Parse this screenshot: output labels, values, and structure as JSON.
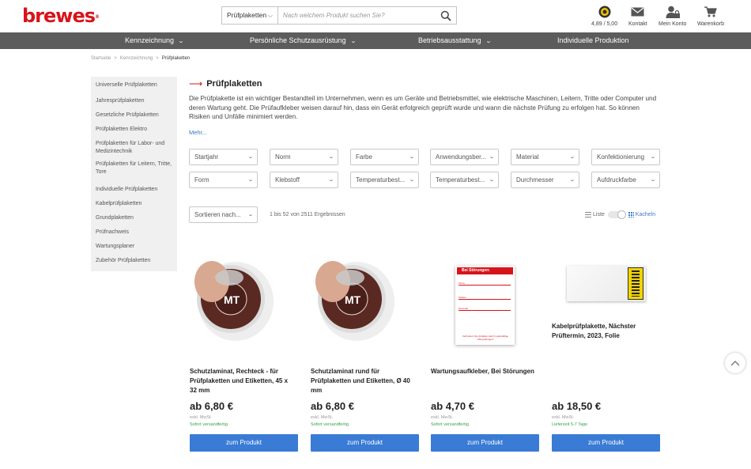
{
  "brand": {
    "logo_text": "brewes",
    "logo_mark": "®",
    "color": "#d8141b"
  },
  "search": {
    "category": "Prüfplaketten",
    "placeholder": "Nach welchem Produkt suchen Sie?"
  },
  "header_links": {
    "rating": "4,89 / 5,00",
    "contact": "Kontakt",
    "account": "Mein Konto",
    "cart": "Warenkorb"
  },
  "nav": [
    {
      "label": "Kennzeichnung",
      "dropdown": true
    },
    {
      "label": "Persönliche Schutzausrüstung",
      "dropdown": true
    },
    {
      "label": "Betriebsausstattung",
      "dropdown": true
    },
    {
      "label": "Individuelle Produktion",
      "dropdown": false
    }
  ],
  "breadcrumb": {
    "home": "Startseite",
    "level1": "Kennzeichnung",
    "current": "Prüfplaketten",
    "separator": ">"
  },
  "sidebar": [
    "Universelle Prüfplaketten",
    "Jahresprüfplaketten",
    "Gesetzliche Prüfplaketten",
    "Prüfplaketten Elektro",
    "Prüfplaketten für Labor- und Medizintechnik",
    "Prüfplaketten für Leitern, Tritte, Tore",
    "Individuelle Prüfplaketten",
    "Kabelprüfplaketten",
    "Grundplaketten",
    "Prüfnachweis",
    "Wartungsplaner",
    "Zubehör Prüfplaketten"
  ],
  "page": {
    "title": "Prüfplaketten",
    "description": "Die Prüfplakette ist ein wichtiger Bestandteil im Unternehmen, wenn es um Geräte und Betriebsmittel, wie elektrische Maschinen, Leitern, Tritte oder Computer und deren Wartung geht. Die Prüfaufkleber weisen darauf hin, dass ein Gerät erfolgreich geprüft wurde und wann die nächste Prüfung zu erfolgen hat. So können Risiken und Unfälle minimiert werden.",
    "more": "Mehr..."
  },
  "filters": [
    "Startjahr",
    "Norm",
    "Farbe",
    "Anwendungsber...",
    "Material",
    "Konfektionierung",
    "Form",
    "Klebstoff",
    "Temperaturbest...",
    "Temperaturbest...",
    "Durchmesser",
    "Aufdruckfarbe"
  ],
  "sort": {
    "label": "Sortieren nach..."
  },
  "results": "1 bis 52 von 2511 Ergebnissen",
  "view": {
    "list": "Liste",
    "tiles": "Kacheln",
    "active": "tiles"
  },
  "products": [
    {
      "name": "Schutzlaminat, Rechteck - für Prüfplaketten und Etiketten, 45 x 32 mm",
      "price": "ab 6,80 €",
      "vat": "exkl. MwSt.",
      "shipping": "Sofort versandfertig",
      "button": "zum Produkt",
      "image": "seal-hand"
    },
    {
      "name": "Schutzlaminat rund für Prüfplaketten und Etiketten, Ø 40 mm",
      "price": "ab 6,80 €",
      "vat": "exkl. MwSt.",
      "shipping": "Sofort versandfertig",
      "button": "zum Produkt",
      "image": "seal-hand"
    },
    {
      "name": "Wartungsaufkleber, Bei Störungen",
      "price": "ab 4,70 €",
      "vat": "exkl. MwSt.",
      "shipping": "Sofort versandfertig",
      "button": "zum Produkt",
      "image": "sticker-card",
      "sticker": {
        "header": "Bei Störungen:",
        "field1": "Firma",
        "field2": "Telefon",
        "field3": "Personal",
        "footer": "Verhindern Sie Schäden durch regelmäßige Überprüfungen!"
      }
    },
    {
      "name": "Kabelprüfplakette, Nächster Prüftermin, 2023, Folie",
      "price": "ab 18,50 €",
      "vat": "exkl. MwSt.",
      "shipping": "Lieferzeit 5-7 Tage",
      "button": "zum Produkt",
      "image": "cable-label"
    }
  ],
  "colors": {
    "nav_bg": "#5c5c5c",
    "button": "#3a7bd5",
    "link": "#3b7ac6",
    "ship_ok": "#37a24a",
    "accent": "#d8141b"
  }
}
